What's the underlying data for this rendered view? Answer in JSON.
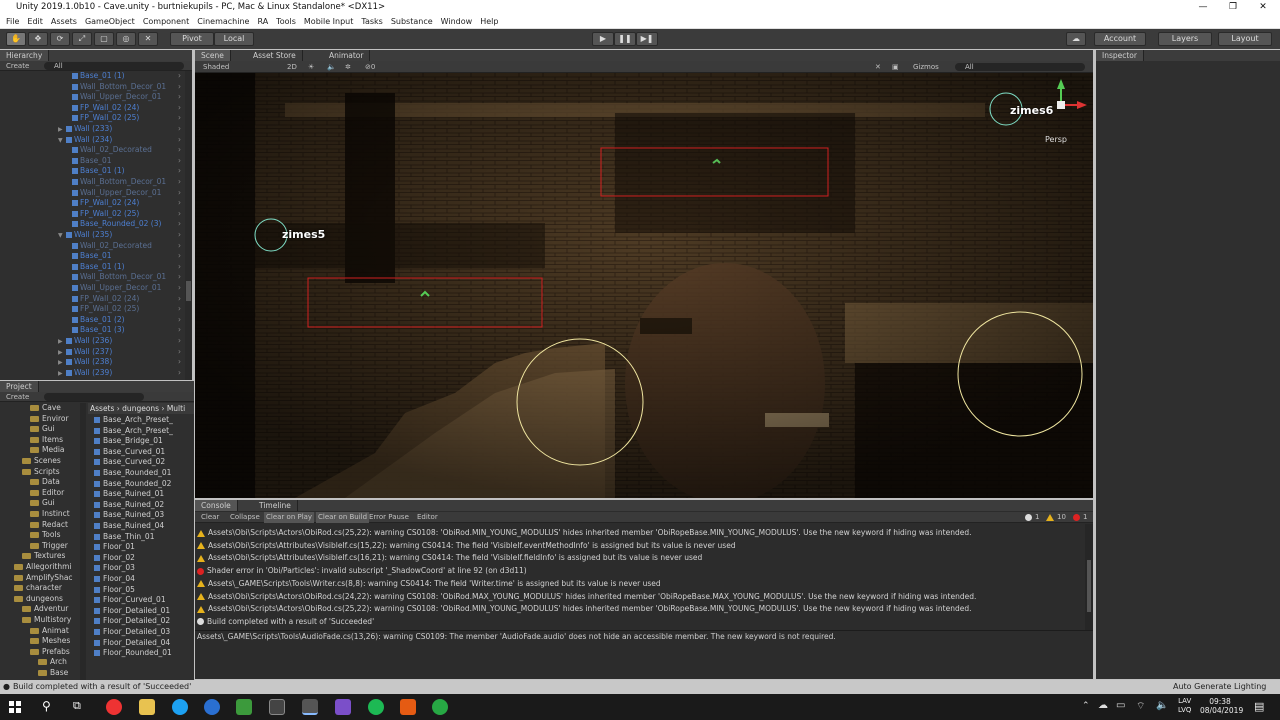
{
  "window": {
    "title": "Unity 2019.1.0b10 - Cave.unity - burtniekupils - PC, Mac & Linux Standalone* <DX11>"
  },
  "menu": [
    "File",
    "Edit",
    "Assets",
    "GameObject",
    "Component",
    "Cinemachine",
    "RA",
    "Tools",
    "Mobile Input",
    "Tasks",
    "Substance",
    "Window",
    "Help"
  ],
  "toolbar": {
    "pivot": "Pivot",
    "local": "Local",
    "account": "Account",
    "layers": "Layers",
    "layout": "Layout"
  },
  "hierarchy": {
    "tab": "Hierarchy",
    "create": "Create",
    "search": "All",
    "rows": [
      {
        "label": "Base_01 (1)",
        "indent": 1,
        "dim": false
      },
      {
        "label": "Wall_Bottom_Decor_01",
        "indent": 1,
        "dim": true
      },
      {
        "label": "Wall_Upper_Decor_01",
        "indent": 1,
        "dim": true
      },
      {
        "label": "FP_Wall_02 (24)",
        "indent": 1,
        "dim": false
      },
      {
        "label": "FP_Wall_02 (25)",
        "indent": 1,
        "dim": false
      },
      {
        "label": "Wall (233)",
        "indent": 0,
        "dim": false,
        "tri": "▶"
      },
      {
        "label": "Wall (234)",
        "indent": 0,
        "dim": false,
        "tri": "▼"
      },
      {
        "label": "Wall_02_Decorated",
        "indent": 1,
        "dim": true
      },
      {
        "label": "Base_01",
        "indent": 1,
        "dim": true
      },
      {
        "label": "Base_01 (1)",
        "indent": 1,
        "dim": false
      },
      {
        "label": "Wall_Bottom_Decor_01",
        "indent": 1,
        "dim": true
      },
      {
        "label": "Wall_Upper_Decor_01",
        "indent": 1,
        "dim": true
      },
      {
        "label": "FP_Wall_02 (24)",
        "indent": 1,
        "dim": false
      },
      {
        "label": "FP_Wall_02 (25)",
        "indent": 1,
        "dim": false
      },
      {
        "label": "Base_Rounded_02 (3)",
        "indent": 1,
        "dim": false
      },
      {
        "label": "Wall (235)",
        "indent": 0,
        "dim": false,
        "tri": "▼"
      },
      {
        "label": "Wall_02_Decorated",
        "indent": 1,
        "dim": true
      },
      {
        "label": "Base_01",
        "indent": 1,
        "dim": false
      },
      {
        "label": "Base_01 (1)",
        "indent": 1,
        "dim": false
      },
      {
        "label": "Wall_Bottom_Decor_01",
        "indent": 1,
        "dim": true
      },
      {
        "label": "Wall_Upper_Decor_01",
        "indent": 1,
        "dim": true
      },
      {
        "label": "FP_Wall_02 (24)",
        "indent": 1,
        "dim": true
      },
      {
        "label": "FP_Wall_02 (25)",
        "indent": 1,
        "dim": true
      },
      {
        "label": "Base_01 (2)",
        "indent": 1,
        "dim": false
      },
      {
        "label": "Base_01 (3)",
        "indent": 1,
        "dim": false
      },
      {
        "label": "Wall (236)",
        "indent": 0,
        "dim": false,
        "tri": "▶"
      },
      {
        "label": "Wall (237)",
        "indent": 0,
        "dim": false,
        "tri": "▶"
      },
      {
        "label": "Wall (238)",
        "indent": 0,
        "dim": false,
        "tri": "▶"
      },
      {
        "label": "Wall (239)",
        "indent": 0,
        "dim": false,
        "tri": "▶"
      }
    ]
  },
  "project": {
    "tab": "Project",
    "create": "Create",
    "breadcrumb": "Assets › dungeons › Multi",
    "tree": [
      {
        "label": "Cave",
        "indent": 2
      },
      {
        "label": "Enviror",
        "indent": 2
      },
      {
        "label": "Gui",
        "indent": 2
      },
      {
        "label": "Items",
        "indent": 2
      },
      {
        "label": "Media",
        "indent": 2
      },
      {
        "label": "Scenes",
        "indent": 1
      },
      {
        "label": "Scripts",
        "indent": 1
      },
      {
        "label": "Data",
        "indent": 2
      },
      {
        "label": "Editor",
        "indent": 2
      },
      {
        "label": "Gui",
        "indent": 2
      },
      {
        "label": "Instinct",
        "indent": 2
      },
      {
        "label": "Redact",
        "indent": 2
      },
      {
        "label": "Tools",
        "indent": 2
      },
      {
        "label": "Trigger",
        "indent": 2
      },
      {
        "label": "Textures",
        "indent": 1
      },
      {
        "label": "Allegorithmi",
        "indent": 0
      },
      {
        "label": "AmplifyShac",
        "indent": 0
      },
      {
        "label": "character",
        "indent": 0
      },
      {
        "label": "dungeons",
        "indent": 0
      },
      {
        "label": "Adventur",
        "indent": 1
      },
      {
        "label": "Multistory",
        "indent": 1
      },
      {
        "label": "Animat",
        "indent": 2
      },
      {
        "label": "Meshes",
        "indent": 2
      },
      {
        "label": "Prefabs",
        "indent": 2
      },
      {
        "label": "Arch",
        "indent": 3
      },
      {
        "label": "Base",
        "indent": 3
      }
    ],
    "files": [
      "Base_Arch_Preset_",
      "Base_Arch_Preset_",
      "Base_Bridge_01",
      "Base_Curved_01",
      "Base_Curved_02",
      "Base_Rounded_01",
      "Base_Rounded_02",
      "Base_Ruined_01",
      "Base_Ruined_02",
      "Base_Ruined_03",
      "Base_Ruined_04",
      "Base_Thin_01",
      "Floor_01",
      "Floor_02",
      "Floor_03",
      "Floor_04",
      "Floor_05",
      "Floor_Curved_01",
      "Floor_Detailed_01",
      "Floor_Detailed_02",
      "Floor_Detailed_03",
      "Floor_Detailed_04",
      "Floor_Rounded_01"
    ]
  },
  "scene": {
    "tabs": [
      "Scene",
      "Asset Store",
      "Animator"
    ],
    "shaded": "Shaded",
    "mode2d": "2D",
    "gizmos": "Gizmos",
    "search": "All",
    "persp": "Persp",
    "labels": [
      "zimes5",
      "zimes6"
    ]
  },
  "inspector": {
    "tab": "Inspector"
  },
  "console": {
    "tabs": [
      "Console",
      "Timeline"
    ],
    "buttons": [
      "Clear",
      "Collapse",
      "Clear on Play",
      "Clear on Build",
      "Error Pause",
      "Editor"
    ],
    "counts": {
      "info": "1",
      "warn": "10",
      "err": "1"
    },
    "lines": [
      {
        "type": "warn",
        "text": "Assets\\Obi\\Scripts\\Actors\\ObiRod.cs(25,22): warning CS0108: 'ObiRod.MIN_YOUNG_MODULUS' hides inherited member 'ObiRopeBase.MIN_YOUNG_MODULUS'. Use the new keyword if hiding was intended."
      },
      {
        "type": "warn",
        "text": "Assets\\Obi\\Scripts\\Attributes\\VisibleIf.cs(15,22): warning CS0414: The field 'VisibleIf.eventMethodInfo' is assigned but its value is never used"
      },
      {
        "type": "warn",
        "text": "Assets\\Obi\\Scripts\\Attributes\\VisibleIf.cs(16,21): warning CS0414: The field 'VisibleIf.fieldInfo' is assigned but its value is never used"
      },
      {
        "type": "err",
        "text": "Shader error in 'Obi/Particles': invalid subscript '_ShadowCoord' at line 92 (on d3d11)"
      },
      {
        "type": "warn",
        "text": "Assets\\_GAME\\Scripts\\Tools\\Writer.cs(8,8): warning CS0414: The field 'Writer.time' is assigned but its value is never used"
      },
      {
        "type": "warn",
        "text": "Assets\\Obi\\Scripts\\Actors\\ObiRod.cs(24,22): warning CS0108: 'ObiRod.MAX_YOUNG_MODULUS' hides inherited member 'ObiRopeBase.MAX_YOUNG_MODULUS'. Use the new keyword if hiding was intended."
      },
      {
        "type": "warn",
        "text": "Assets\\Obi\\Scripts\\Actors\\ObiRod.cs(25,22): warning CS0108: 'ObiRod.MIN_YOUNG_MODULUS' hides inherited member 'ObiRopeBase.MIN_YOUNG_MODULUS'. Use the new keyword if hiding was intended."
      },
      {
        "type": "info",
        "text": "Build completed with a result of 'Succeeded'"
      }
    ],
    "detail": "Assets\\_GAME\\Scripts\\Tools\\AudioFade.cs(13,26): warning CS0109: The member 'AudioFade.audio' does not hide an accessible member. The new keyword is not required."
  },
  "statusbar": {
    "message": "Build completed with a result of 'Succeeded'",
    "right": "Auto Generate Lighting Off"
  },
  "taskbar": {
    "lang1": "LAV",
    "lang2": "LVQ",
    "time": "09:38",
    "date": "08/04/2019"
  }
}
